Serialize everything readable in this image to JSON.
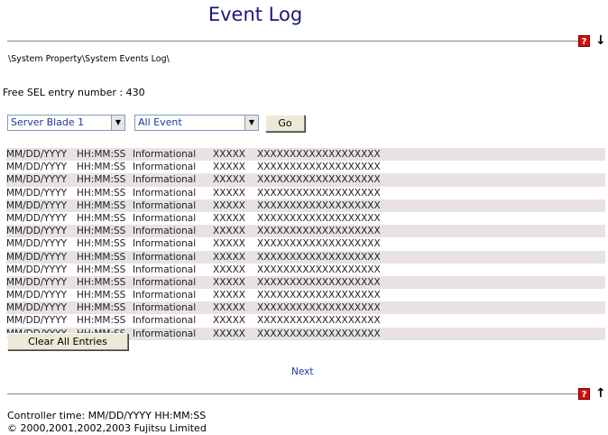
{
  "page": {
    "title": "Event Log",
    "breadcrumb": "\\System Property\\System Events Log\\",
    "free_sel_label": "Free SEL entry number : 430"
  },
  "icons": {
    "help": "help-icon",
    "down": "arrow-down-icon",
    "up": "arrow-up-icon",
    "help_glyph": "?",
    "down_glyph": "↓",
    "up_glyph": "↑",
    "dropdown_glyph": "▼"
  },
  "filters": {
    "blade_select_value": "Server Blade 1",
    "event_select_value": "All Event",
    "go_label": "Go"
  },
  "log": {
    "rows": [
      [
        "MM/DD/YYYY",
        "HH:MM:SS",
        "Informational",
        "XXXXX",
        "XXXXXXXXXXXXXXXXXXX"
      ],
      [
        "MM/DD/YYYY",
        "HH:MM:SS",
        "Informational",
        "XXXXX",
        "XXXXXXXXXXXXXXXXXXX"
      ],
      [
        "MM/DD/YYYY",
        "HH:MM:SS",
        "Informational",
        "XXXXX",
        "XXXXXXXXXXXXXXXXXXX"
      ],
      [
        "MM/DD/YYYY",
        "HH:MM:SS",
        "Informational",
        "XXXXX",
        "XXXXXXXXXXXXXXXXXXX"
      ],
      [
        "MM/DD/YYYY",
        "HH:MM:SS",
        "Informational",
        "XXXXX",
        "XXXXXXXXXXXXXXXXXXX"
      ],
      [
        "MM/DD/YYYY",
        "HH:MM:SS",
        "Informational",
        "XXXXX",
        "XXXXXXXXXXXXXXXXXXX"
      ],
      [
        "MM/DD/YYYY",
        "HH:MM:SS",
        "Informational",
        "XXXXX",
        "XXXXXXXXXXXXXXXXXXX"
      ],
      [
        "MM/DD/YYYY",
        "HH:MM:SS",
        "Informational",
        "XXXXX",
        "XXXXXXXXXXXXXXXXXXX"
      ],
      [
        "MM/DD/YYYY",
        "HH:MM:SS",
        "Informational",
        "XXXXX",
        "XXXXXXXXXXXXXXXXXXX"
      ],
      [
        "MM/DD/YYYY",
        "HH:MM:SS",
        "Informational",
        "XXXXX",
        "XXXXXXXXXXXXXXXXXXX"
      ],
      [
        "MM/DD/YYYY",
        "HH:MM:SS",
        "Informational",
        "XXXXX",
        "XXXXXXXXXXXXXXXXXXX"
      ],
      [
        "MM/DD/YYYY",
        "HH:MM:SS",
        "Informational",
        "XXXXX",
        "XXXXXXXXXXXXXXXXXXX"
      ],
      [
        "MM/DD/YYYY",
        "HH:MM:SS",
        "Informational",
        "XXXXX",
        "XXXXXXXXXXXXXXXXXXX"
      ],
      [
        "MM/DD/YYYY",
        "HH:MM:SS",
        "Informational",
        "XXXXX",
        "XXXXXXXXXXXXXXXXXXX"
      ],
      [
        "MM/DD/YYYY",
        "HH:MM:SS",
        "Informational",
        "XXXXX",
        "XXXXXXXXXXXXXXXXXXX"
      ]
    ],
    "clear_label": "Clear All Entries",
    "next_label": "Next"
  },
  "footer": {
    "controller_time": "Controller time: MM/DD/YYYY HH:MM:SS",
    "copyright": "© 2000,2001,2002,2003 Fujitsu Limited"
  },
  "colors": {
    "title": "#1a1a7a",
    "link": "#1a3a99",
    "row_shade": "#e8e2e4",
    "help_red": "#cc1111"
  }
}
